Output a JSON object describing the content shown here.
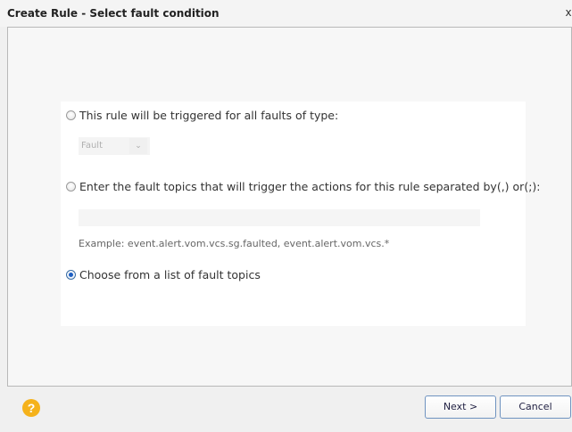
{
  "dialog": {
    "title": "Create Rule - Select fault condition",
    "close_label": "x"
  },
  "options": {
    "all_faults": {
      "label": "This rule will be triggered for all faults of type:",
      "selected": false
    },
    "fault_type_select": {
      "value": "Fault",
      "enabled": false
    },
    "enter_topics": {
      "label": "Enter the fault topics that will trigger the actions for this rule separated by(,) or(;):",
      "selected": false
    },
    "topics_input": {
      "value": "",
      "placeholder": ""
    },
    "example": "Example: event.alert.vom.vcs.sg.faulted, event.alert.vom.vcs.*",
    "choose_list": {
      "label": "Choose from a list of fault topics",
      "selected": true
    }
  },
  "footer": {
    "help_symbol": "?",
    "next_label": "Next >",
    "cancel_label": "Cancel"
  },
  "icons": {
    "help": "help-icon",
    "close": "close-icon",
    "dropdown": "chevron-down-icon"
  },
  "colors": {
    "accent": "#1c5ec3",
    "help": "#f5b21b",
    "button_border": "#6f93c0"
  }
}
